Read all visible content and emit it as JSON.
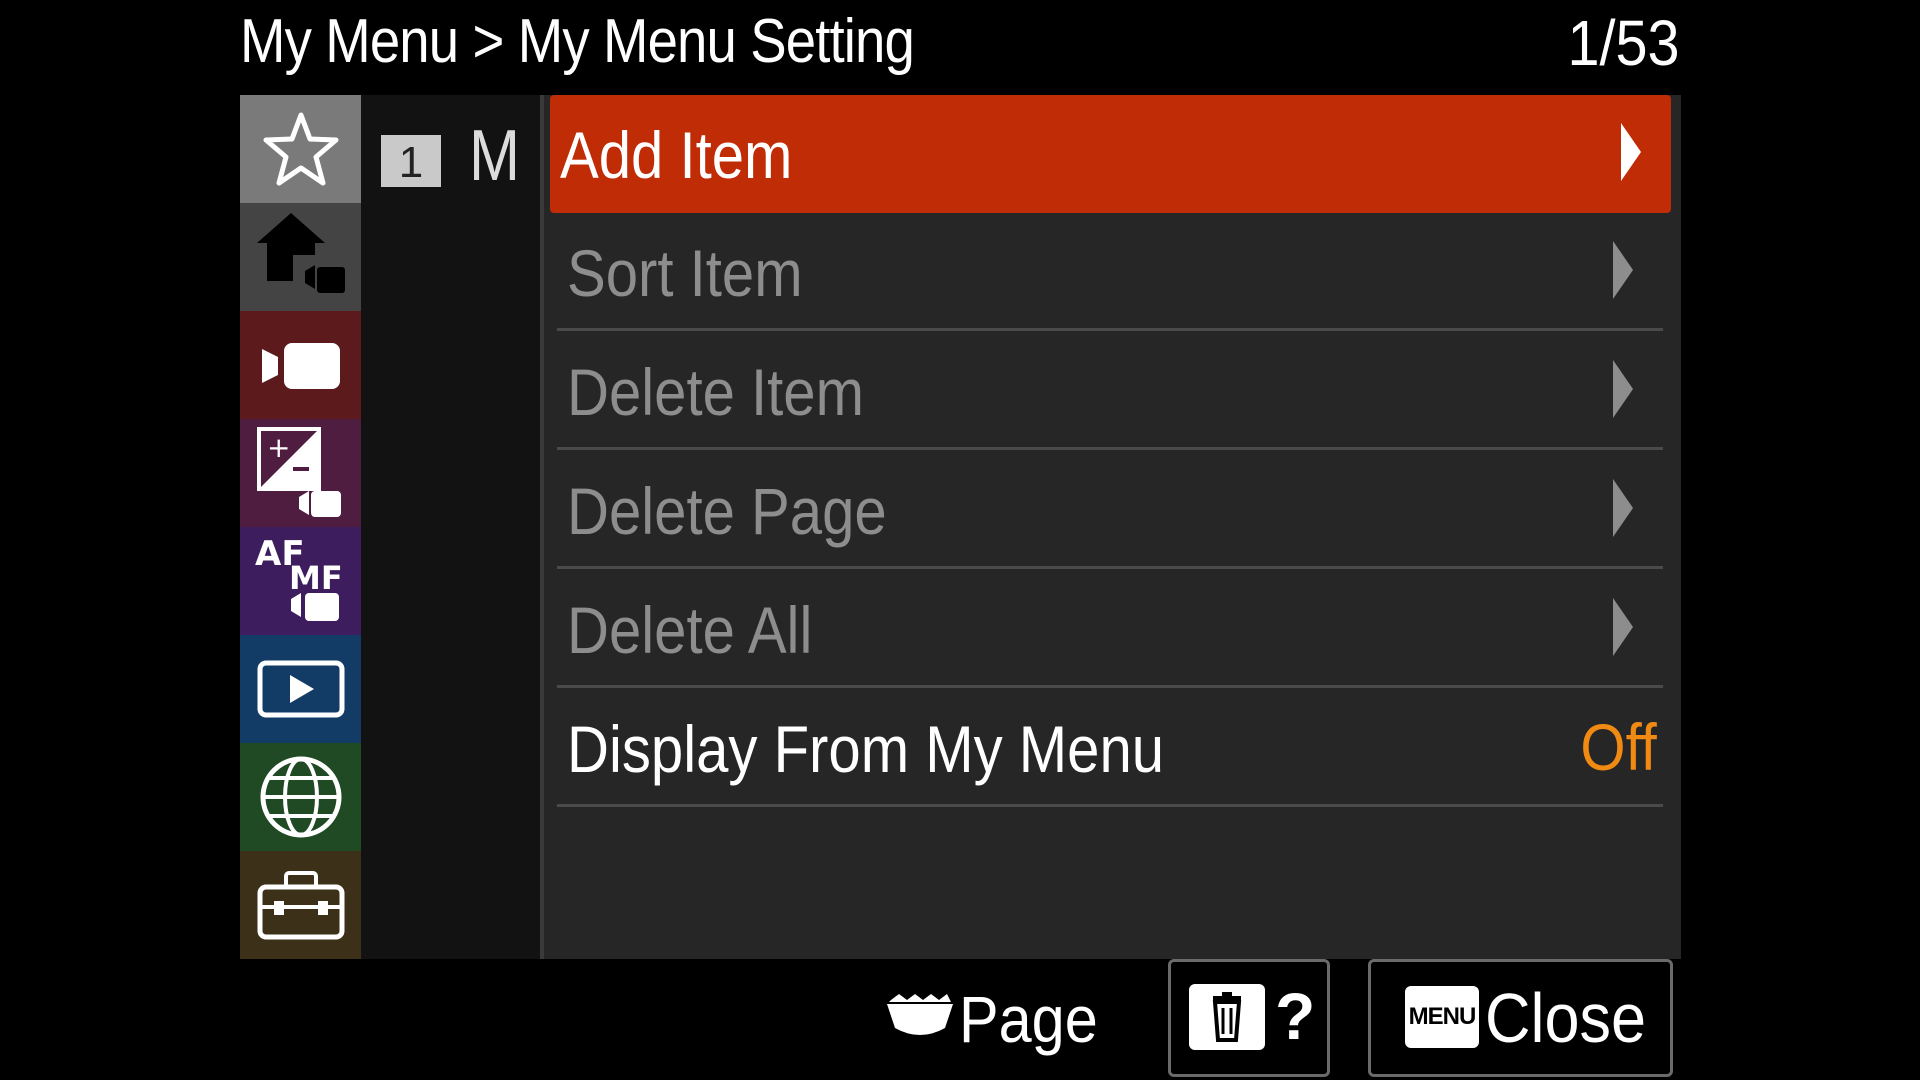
{
  "header": {
    "title": "My Menu > My Menu Setting",
    "page_count": "1/53"
  },
  "sidebar": {
    "items": [
      {
        "name": "my-menu",
        "icon": "star-icon",
        "color": "#7a7a7a",
        "selected": true
      },
      {
        "name": "main",
        "icon": "home-camera-icon",
        "color": "#444444"
      },
      {
        "name": "shooting",
        "icon": "camera-movie-icon",
        "color": "#5c1a1d"
      },
      {
        "name": "exposure-color",
        "icon": "exposure-icon",
        "color": "#4e1d3f"
      },
      {
        "name": "focus",
        "icon": "af-mf-icon",
        "color": "#3d1d5e"
      },
      {
        "name": "playback",
        "icon": "playback-icon",
        "color": "#123c66"
      },
      {
        "name": "network",
        "icon": "globe-icon",
        "color": "#1f4a24"
      },
      {
        "name": "setup",
        "icon": "toolbox-icon",
        "color": "#3d3018"
      }
    ]
  },
  "subtab": {
    "number": "1",
    "label": "M"
  },
  "menu": {
    "items": [
      {
        "label": "Add Item",
        "state": "selected"
      },
      {
        "label": "Sort Item",
        "state": "disabled"
      },
      {
        "label": "Delete Item",
        "state": "disabled"
      },
      {
        "label": "Delete Page",
        "state": "disabled"
      },
      {
        "label": "Delete All",
        "state": "disabled"
      },
      {
        "label": "Display From My Menu",
        "value": "Off",
        "state": "normal"
      }
    ]
  },
  "footer": {
    "page_label": "Page",
    "help_label": "?",
    "menu_badge": "MENU",
    "close_label": "Close"
  },
  "colors": {
    "selected_row": "#c02c06",
    "value_text": "#f08a12",
    "disabled_text": "#8d8d8d"
  }
}
